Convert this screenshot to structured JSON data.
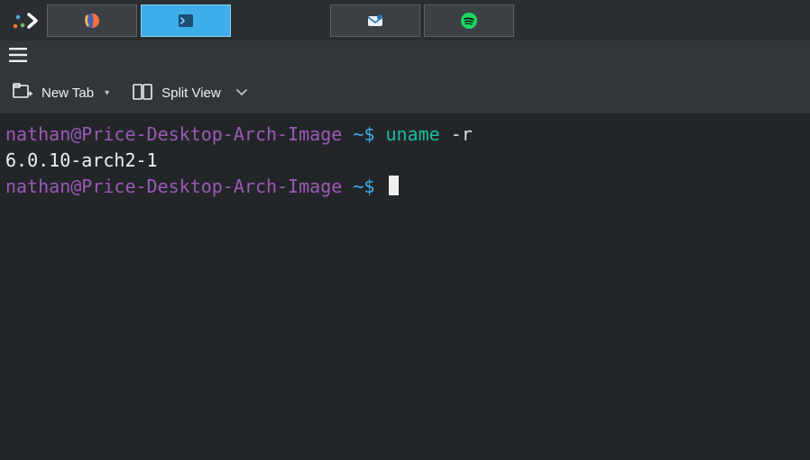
{
  "taskbar": {
    "launcher_icon": "plasma-launcher",
    "items": [
      {
        "name": "firefox",
        "active": false
      },
      {
        "name": "konsole",
        "active": true
      },
      {
        "name": "email",
        "active": false
      },
      {
        "name": "spotify",
        "active": false
      }
    ]
  },
  "toolbar": {
    "new_tab_label": "New Tab",
    "split_view_label": "Split View"
  },
  "terminal": {
    "user_host": "nathan@Price-Desktop-Arch-Image",
    "path_prompt": "~",
    "prompt_symbol": "$",
    "command": "uname",
    "args": "-r",
    "output": "6.0.10-arch2-1"
  }
}
